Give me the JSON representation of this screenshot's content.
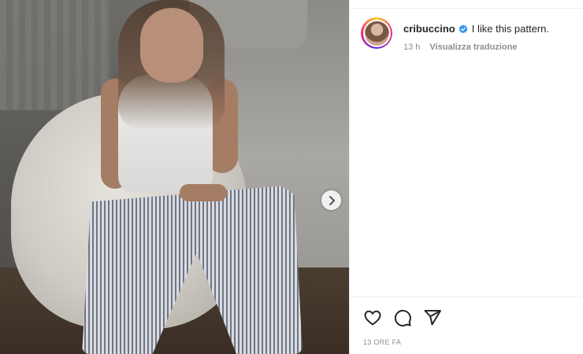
{
  "post": {
    "username": "cribuccino",
    "verified": true,
    "caption": "I like this pattern.",
    "relative_time": "13 h",
    "translate_label": "Visualizza traduzione",
    "timestamp": "13 ORE FA"
  },
  "icons": {
    "next": "chevron-right-icon",
    "like": "heart-icon",
    "comment": "comment-icon",
    "share": "paper-plane-icon",
    "verified": "verified-badge-icon"
  },
  "colors": {
    "verified_blue": "#3897f0",
    "secondary_text": "#8e8e8e",
    "primary_text": "#262626"
  }
}
